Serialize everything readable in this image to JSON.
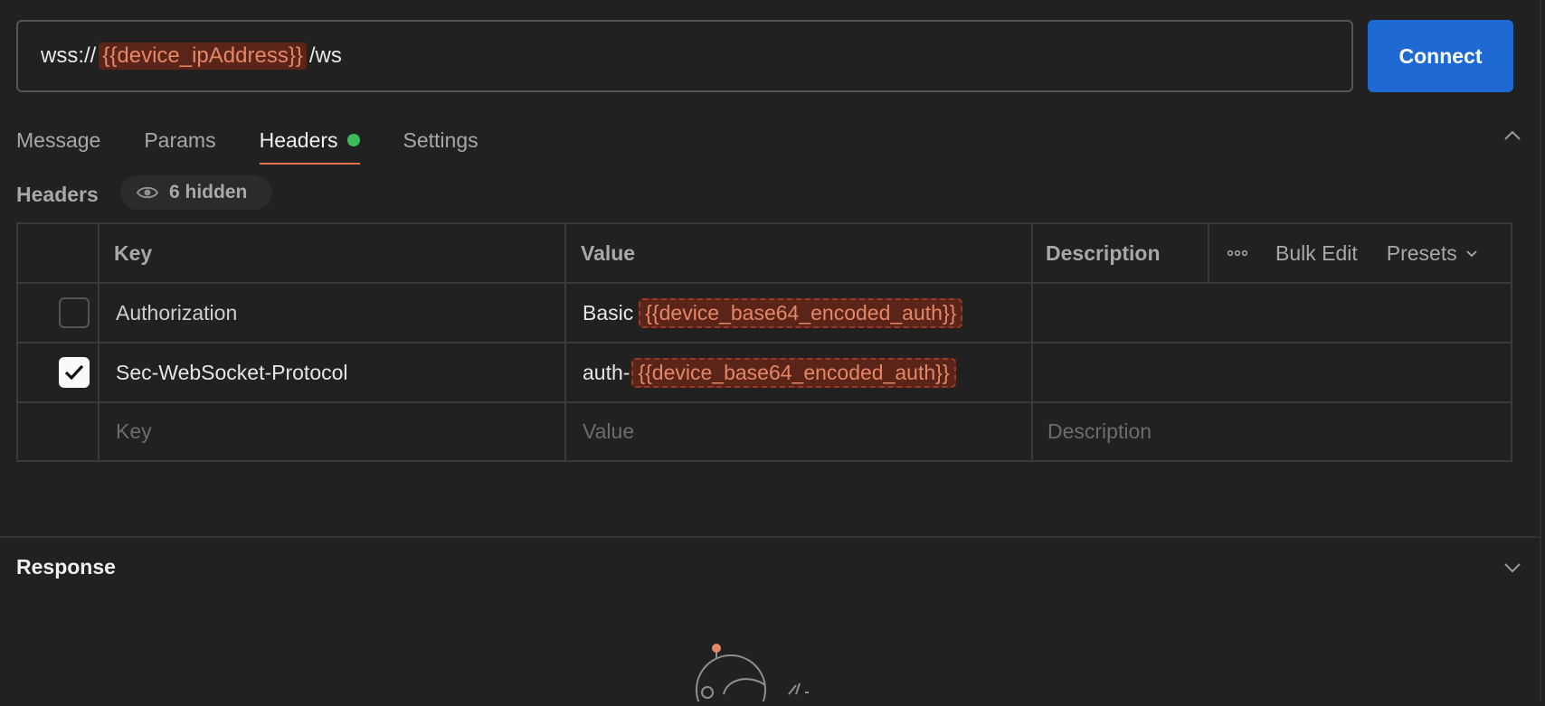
{
  "url_bar": {
    "prefix": "wss://",
    "variable": "{{device_ipAddress}}",
    "suffix": "/ws",
    "connect_label": "Connect"
  },
  "tabs": [
    {
      "label": "Message",
      "active": false
    },
    {
      "label": "Params",
      "active": false
    },
    {
      "label": "Headers",
      "active": true,
      "indicator": "green-dot"
    },
    {
      "label": "Settings",
      "active": false
    }
  ],
  "headers_section": {
    "title": "Headers",
    "hidden_count_label": "6 hidden",
    "hidden_icon": "eye-icon"
  },
  "table": {
    "columns": {
      "key": "Key",
      "value": "Value",
      "description": "Description"
    },
    "actions": {
      "more_icon": "ellipsis-icon",
      "bulk_edit": "Bulk Edit",
      "presets": "Presets"
    },
    "rows": [
      {
        "checked": false,
        "key": "Authorization",
        "value_prefix": "Basic",
        "value_variable": "{{device_base64_encoded_auth}}",
        "description": ""
      },
      {
        "checked": true,
        "key": "Sec-WebSocket-Protocol",
        "value_prefix": "auth-",
        "value_variable": "{{device_base64_encoded_auth}}",
        "description": ""
      }
    ],
    "new_row_placeholders": {
      "key": "Key",
      "value": "Value",
      "description": "Description"
    }
  },
  "response": {
    "title": "Response",
    "illustration": "astronaut-illustration"
  },
  "colors": {
    "background": "#212121",
    "primary_button": "#1f6ad2",
    "active_tab_underline": "#e7744a",
    "indicator_dot": "#3dbb5b",
    "variable_text": "#e58766",
    "variable_bg": "#5a2418"
  }
}
